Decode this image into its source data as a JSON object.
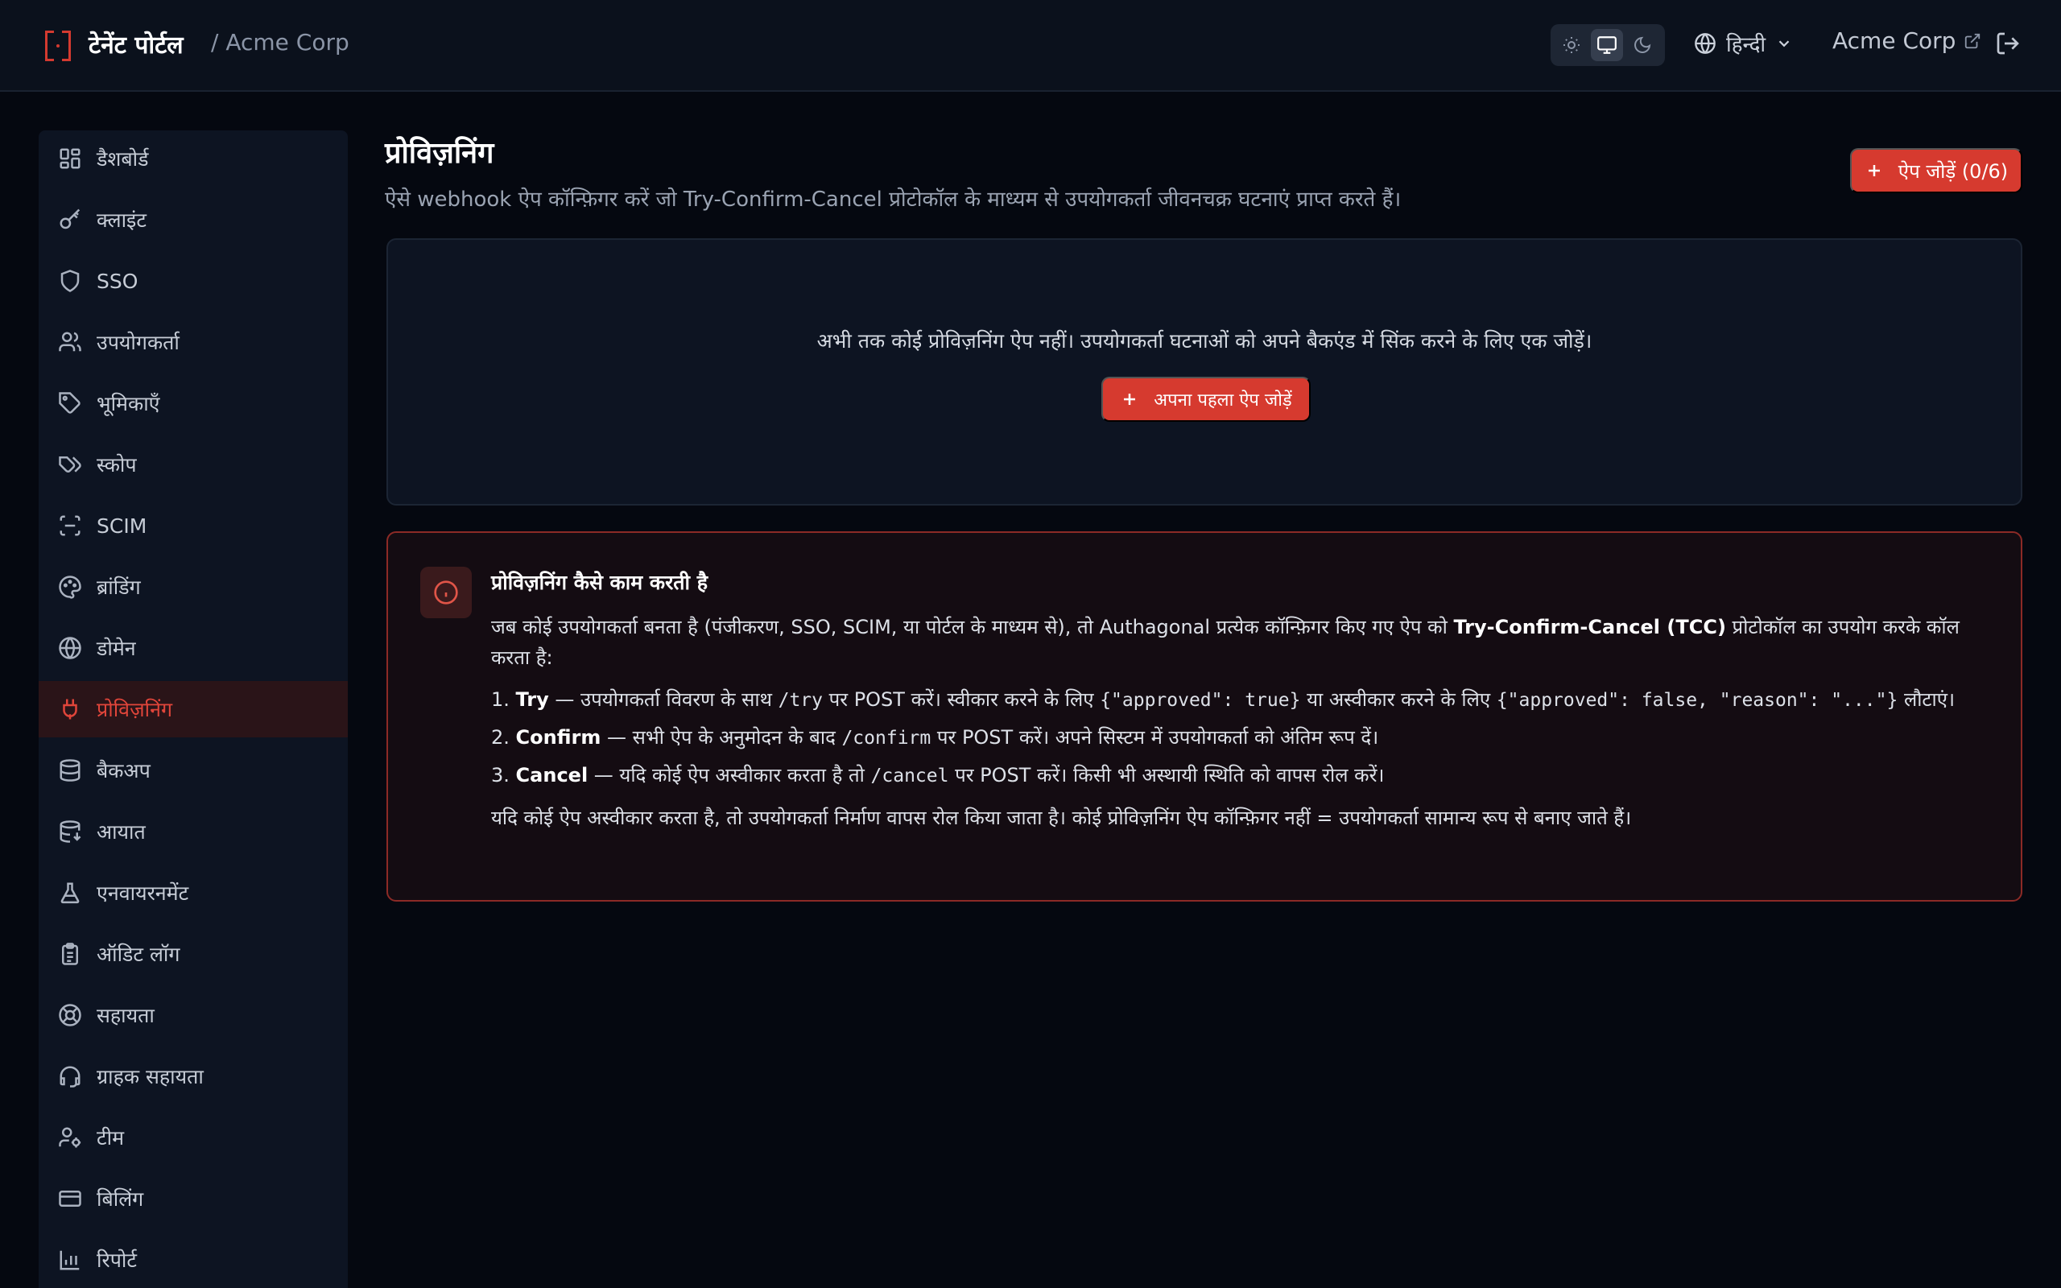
{
  "header": {
    "title": "टेनेंट पोर्टल",
    "org_prefix": "/ Acme Corp",
    "language": "हिन्दी",
    "org_link": "Acme Corp"
  },
  "sidebar": {
    "items": [
      {
        "label": "डैशबोर्ड",
        "icon": "dashboard-icon"
      },
      {
        "label": "क्लाइंट",
        "icon": "key-icon"
      },
      {
        "label": "SSO",
        "icon": "shield-icon"
      },
      {
        "label": "उपयोगकर्ता",
        "icon": "users-icon"
      },
      {
        "label": "भूमिकाएँ",
        "icon": "tag-icon"
      },
      {
        "label": "स्कोप",
        "icon": "tags-icon"
      },
      {
        "label": "SCIM",
        "icon": "scan-icon"
      },
      {
        "label": "ब्रांडिंग",
        "icon": "palette-icon"
      },
      {
        "label": "डोमेन",
        "icon": "globe-icon"
      },
      {
        "label": "प्रोविज़निंग",
        "icon": "plug-icon",
        "active": true
      },
      {
        "label": "बैकअप",
        "icon": "database-icon"
      },
      {
        "label": "आयात",
        "icon": "database-import-icon"
      },
      {
        "label": "एनवायरनमेंट",
        "icon": "flask-icon"
      },
      {
        "label": "ऑडिट लॉग",
        "icon": "clipboard-icon"
      },
      {
        "label": "सहायता",
        "icon": "lifebuoy-icon"
      },
      {
        "label": "ग्राहक सहायता",
        "icon": "headset-icon"
      },
      {
        "label": "टीम",
        "icon": "user-cog-icon"
      },
      {
        "label": "बिलिंग",
        "icon": "credit-card-icon"
      },
      {
        "label": "रिपोर्ट",
        "icon": "bar-chart-icon"
      }
    ]
  },
  "main": {
    "title": "प्रोविज़निंग",
    "description": "ऐसे webhook ऐप कॉन्फ़िगर करें जो Try-Confirm-Cancel प्रोटोकॉल के माध्यम से उपयोगकर्ता जीवनचक्र घटनाएं प्राप्त करते हैं।",
    "add_button": "ऐप जोड़ें (0/6)",
    "empty_text": "अभी तक कोई प्रोविज़निंग ऐप नहीं। उपयोगकर्ता घटनाओं को अपने बैकएंड में सिंक करने के लिए एक जोड़ें।",
    "first_app_button": "अपना पहला ऐप जोड़ें"
  },
  "info": {
    "title": "प्रोविज़निंग कैसे काम करती है",
    "intro_a": "जब कोई उपयोगकर्ता बनता है (पंजीकरण, SSO, SCIM, या पोर्टल के माध्यम से), तो Authagonal प्रत्येक कॉन्फ़िगर किए गए ऐप को ",
    "intro_bold": "Try-Confirm-Cancel (TCC)",
    "intro_b": " प्रोटोकॉल का उपयोग करके कॉल करता है:",
    "step1_num": "1.",
    "step1_name": "Try",
    "step1_a": " — उपयोगकर्ता विवरण के साथ ",
    "step1_code1": "/try",
    "step1_b": " पर POST करें। स्वीकार करने के लिए ",
    "step1_code2": "{\"approved\": true}",
    "step1_c": " या अस्वीकार करने के लिए ",
    "step1_code3": "{\"approved\": false, \"reason\": \"...\"}",
    "step1_d": " लौटाएं।",
    "step2_num": "2.",
    "step2_name": "Confirm",
    "step2_a": " — सभी ऐप के अनुमोदन के बाद ",
    "step2_code": "/confirm",
    "step2_b": " पर POST करें। अपने सिस्टम में उपयोगकर्ता को अंतिम रूप दें।",
    "step3_num": "3.",
    "step3_name": "Cancel",
    "step3_a": " — यदि कोई ऐप अस्वीकार करता है तो ",
    "step3_code": "/cancel",
    "step3_b": " पर POST करें। किसी भी अस्थायी स्थिति को वापस रोल करें।",
    "footer": "यदि कोई ऐप अस्वीकार करता है, तो उपयोगकर्ता निर्माण वापस रोल किया जाता है। कोई प्रोविज़निंग ऐप कॉन्फ़िगर नहीं = उपयोगकर्ता सामान्य रूप से बनाए जाते हैं।"
  },
  "colors": {
    "accent": "#d63a2f",
    "background": "#050810",
    "sidebar": "#0d1422",
    "info_border": "#8c2a26"
  }
}
